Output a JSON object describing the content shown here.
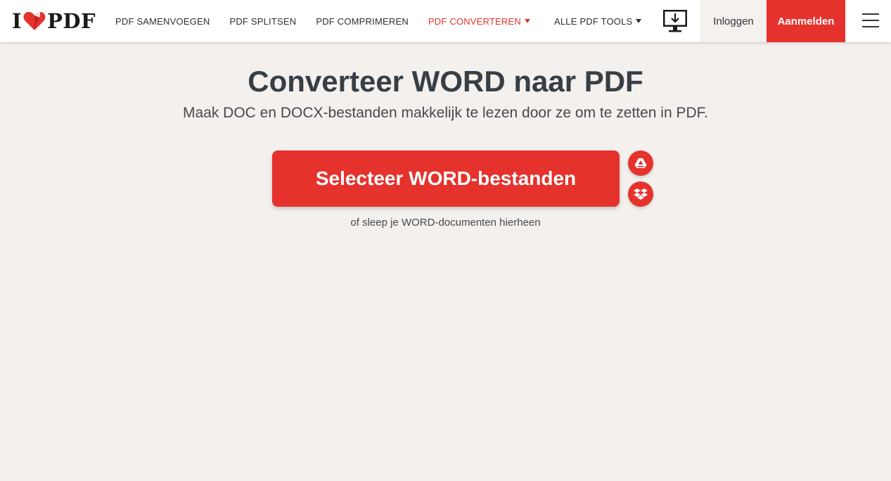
{
  "brand": {
    "logo_left": "I",
    "logo_right": "PDF",
    "accent_color": "#e5322d"
  },
  "nav": {
    "items": [
      {
        "label": "PDF samenvoegen"
      },
      {
        "label": "PDF splitsen"
      },
      {
        "label": "PDF comprimeren"
      },
      {
        "label": "PDF converteren"
      },
      {
        "label": "Alle PDF tools"
      }
    ],
    "active_index": 3
  },
  "header": {
    "login_label": "Inloggen",
    "signup_label": "Aanmelden",
    "desktop_icon": "desktop-download-icon",
    "menu_icon": "hamburger-menu-icon"
  },
  "main": {
    "title": "Converteer WORD naar PDF",
    "subtitle": "Maak DOC en DOCX-bestanden makkelijk te lezen door ze om te zetten in PDF.",
    "select_label": "Selecteer WORD-bestanden",
    "drop_hint": "of sleep je WORD-documenten hierheen",
    "cloud_icons": [
      "google-drive-icon",
      "dropbox-icon"
    ]
  }
}
